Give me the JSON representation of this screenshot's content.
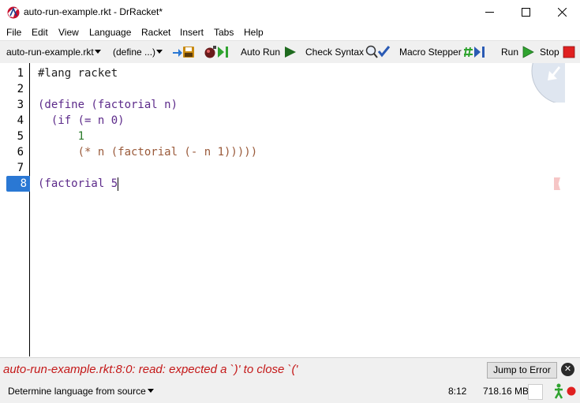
{
  "window": {
    "title": "auto-run-example.rkt - DrRacket*",
    "minimize_glyph": "—",
    "maximize_glyph": "☐",
    "close_glyph": "✕"
  },
  "menu": [
    "File",
    "Edit",
    "View",
    "Language",
    "Racket",
    "Insert",
    "Tabs",
    "Help"
  ],
  "toolbar": {
    "file_dropdown": "auto-run-example.rkt",
    "define_dropdown": "(define ...)",
    "auto_run": "Auto Run",
    "check_syntax": "Check Syntax",
    "macro_stepper": "Macro Stepper",
    "run": "Run",
    "stop": "Stop"
  },
  "editor": {
    "line_numbers": [
      "1",
      "2",
      "3",
      "4",
      "5",
      "6",
      "7",
      "8"
    ],
    "active_line": "8",
    "lines": [
      "#lang racket",
      "",
      "(define (factorial n)",
      "  (if (= n 0)",
      "      1",
      "      (* n (factorial (- n 1)))))",
      "",
      "(factorial 5"
    ]
  },
  "error": {
    "message": "auto-run-example.rkt:8:0: read: expected a `)' to close `('",
    "jump_button": "Jump to Error"
  },
  "status": {
    "language": "Determine language from source",
    "position": "8:12",
    "memory": "718.16 MB"
  },
  "colors": {
    "error_text": "#c41818",
    "active_line_bg": "#2a78d4",
    "stop_red": "#e02020",
    "run_green": "#2fa32f"
  }
}
